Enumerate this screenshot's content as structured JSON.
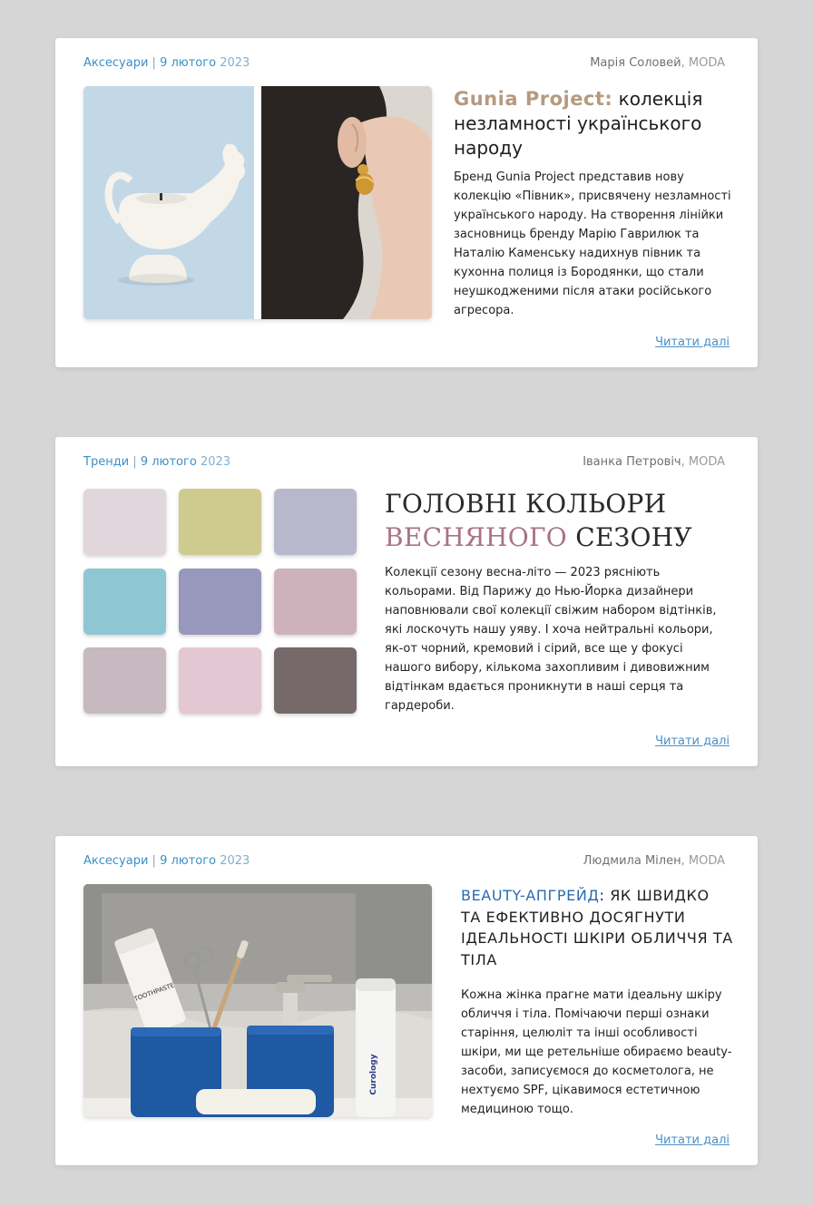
{
  "cards": [
    {
      "category": "Аксесуари",
      "separator": "|",
      "date": "9 лютого",
      "year": "2023",
      "author": "Марія Соловей",
      "publication": ", MODA",
      "title_accent": "Gunia Project:",
      "title_rest": " колекція незламності українського народу",
      "body": "Бренд Gunia Project представив нову колекцію «Півник», присвячену незламності українського народу. На створення лінійки засновниць бренду Марію Гаврилюк та Наталію Каменську надихнув півник та кухонна полиця із Бородянки, що стали неушкодженими після атаки російського агресора.",
      "read_more": "Читати далі"
    },
    {
      "category": "Тренди",
      "separator": "|",
      "date": "9 лютого",
      "year": "2023",
      "author": "Іванка Петровіч",
      "publication": ", MODA",
      "title_line1": "ГОЛОВНІ КОЛЬОРИ",
      "title_accent": "ВЕСНЯНОГО",
      "title_rest": " СЕЗОНУ",
      "body": "Колекції сезону весна-літо — 2023 рясніють кольорами. Від Парижу до Нью-Йорка дизайнери наповнювали свої колекції свіжим набором відтінків, які лоскочуть нашу уяву. І хоча нейтральні кольори, як-от чорний, кремовий і сірий, все ще у фокусі нашого вибору, кількома захопливим і дивовижним відтінкам вдається проникнути в наші серця та гардероби.",
      "read_more": "Читати далі",
      "swatch_colors": [
        "#e0d6dc",
        "#cfca8e",
        "#b8b8cc",
        "#8fc6d3",
        "#9898bc",
        "#cdb2bc",
        "#c6b9bf",
        "#e3c7d3",
        "#75696a"
      ]
    },
    {
      "category": "Аксесуари",
      "separator": "|",
      "date": "9 лютого",
      "year": "2023",
      "author": "Людмила Мілен",
      "publication": ", MODA",
      "title_accent": "BEAUTY-АПГРЕЙД",
      "title_rest": ": ЯК ШВИДКО ТА ЕФЕКТИВНО ДОСЯГНУТИ ІДЕАЛЬНОСТІ ШКІРИ ОБЛИЧЧЯ ТА ТІЛА",
      "body": "Кожна жінка прагне мати ідеальну шкіру обличчя і тіла. Помічаючи перші ознаки старіння, целюліт та інші особливості шкіри, ми ще ретельніше обираємо beauty-засоби, записуємося до косметолога, не нехтуємо SPF, цікавимося естетичною медициною тощо.",
      "read_more": "Читати далі",
      "product_labels": {
        "toothpaste": "TOOTHPASTE",
        "bottle": "Curology"
      }
    }
  ]
}
